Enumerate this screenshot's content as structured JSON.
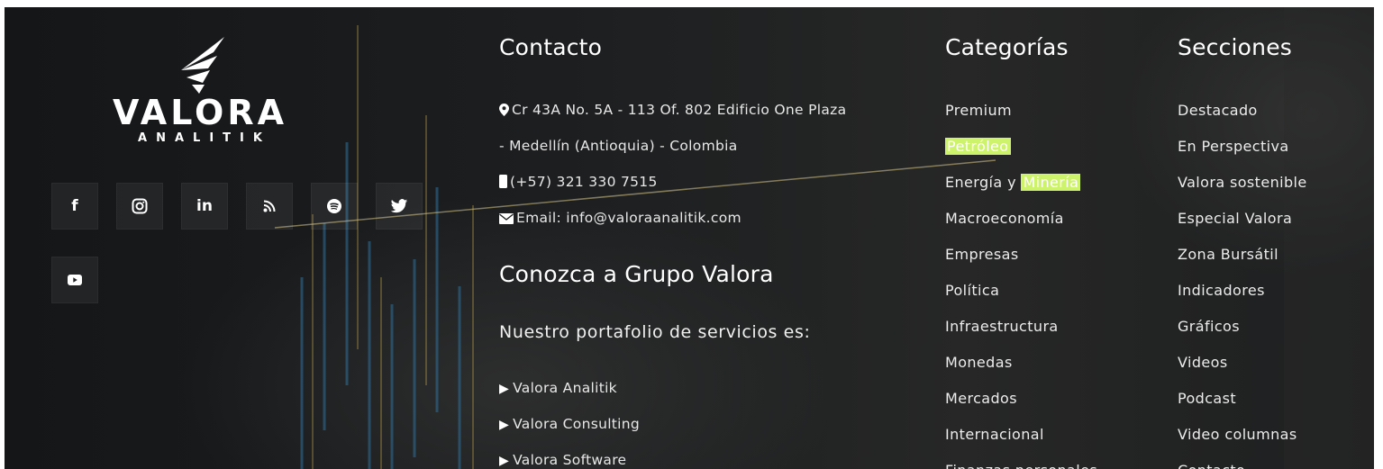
{
  "brand": {
    "name": "VALORA",
    "sub": "ANALITIK"
  },
  "social": [
    {
      "name": "facebook-icon",
      "label": "f"
    },
    {
      "name": "instagram-icon",
      "label": ""
    },
    {
      "name": "linkedin-icon",
      "label": "in"
    },
    {
      "name": "rss-icon",
      "label": ""
    },
    {
      "name": "spotify-icon",
      "label": ""
    },
    {
      "name": "twitter-icon",
      "label": ""
    },
    {
      "name": "youtube-icon",
      "label": ""
    }
  ],
  "contacto": {
    "title": "Contacto",
    "address_line1": "Cr 43A No. 5A - 113 Of. 802 Edificio One Plaza",
    "address_line2": "- Medellín (Antioquia) - Colombia",
    "phone": "(+57) 321 330 7515",
    "email": "Email: info@valoraanalitik.com"
  },
  "grupo": {
    "title": "Conozca a Grupo Valora",
    "subtitle": "Nuestro portafolio de servicios es:",
    "items": [
      "Valora Analitik",
      "Valora Consulting",
      "Valora Software"
    ]
  },
  "categorias": {
    "title": "Categorías",
    "items": {
      "premium": "Premium",
      "petroleo": "Petróleo",
      "energia_a": "Energía y ",
      "energia_b": "Minería",
      "macro": "Macroeconomía",
      "empresas": "Empresas",
      "politica": "Política",
      "infra": "Infraestructura",
      "monedas": "Monedas",
      "mercados": "Mercados",
      "internacional": "Internacional",
      "finanzas": "Finanzas personales"
    }
  },
  "secciones": {
    "title": "Secciones",
    "items": [
      "Destacado",
      "En Perspectiva",
      "Valora sostenible",
      "Especial Valora",
      "Zona Bursátil",
      "Indicadores",
      "Gráficos",
      "Videos",
      "Podcast",
      "Video columnas",
      "Contacto"
    ]
  },
  "colors": {
    "highlight": "#cdf26b",
    "background": "#1c1e20",
    "text": "#e8e8e8"
  }
}
